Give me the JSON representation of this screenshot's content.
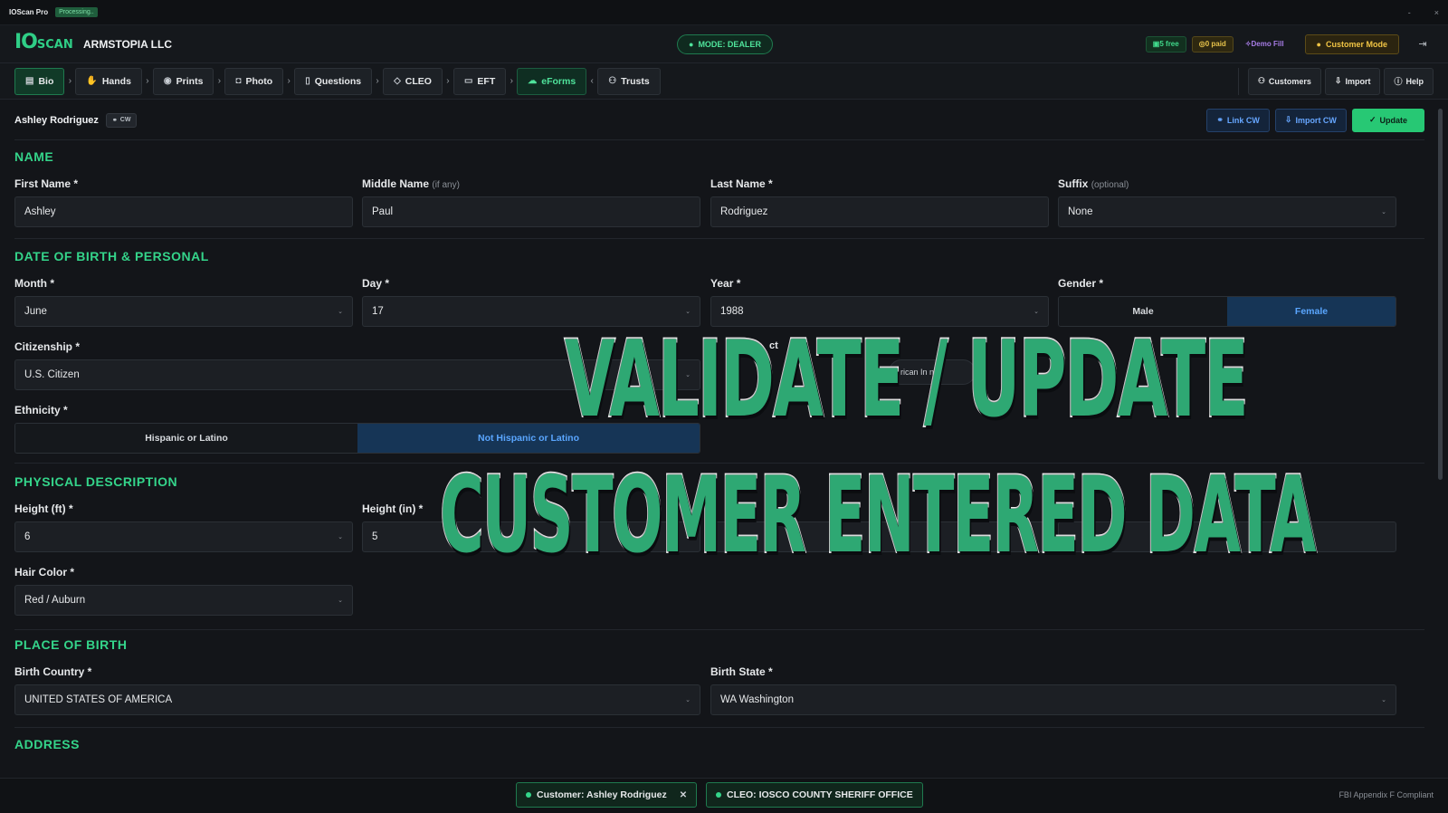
{
  "titlebar": {
    "app": "IOScan Pro",
    "status": "Processing..",
    "minimize": "-",
    "close": "×"
  },
  "header": {
    "logo_main": "IO",
    "logo_sub": "SCAN",
    "company": "ARMSTOPIA LLC",
    "mode": "MODE: DEALER",
    "free": "5 free",
    "paid": "0 paid",
    "demo": "Demo Fill",
    "customer_mode": "Customer Mode"
  },
  "nav": {
    "tabs": [
      "Bio",
      "Hands",
      "Prints",
      "Photo",
      "Questions",
      "CLEO",
      "EFT",
      "eForms",
      "Trusts"
    ],
    "right": [
      "Customers",
      "Import",
      "Help"
    ]
  },
  "person": {
    "name": "Ashley Rodriguez",
    "tag": "CW",
    "link_cw": "Link CW",
    "import_cw": "Import CW",
    "update": "Update"
  },
  "name_section": {
    "title": "NAME",
    "first_label": "First Name *",
    "first": "Ashley",
    "middle_label": "Middle Name",
    "middle_hint": "(if any)",
    "middle": "Paul",
    "last_label": "Last Name *",
    "last": "Rodriguez",
    "suffix_label": "Suffix",
    "suffix_hint": "(optional)",
    "suffix": "None"
  },
  "dob_section": {
    "title": "DATE OF BIRTH & PERSONAL",
    "month_label": "Month *",
    "month": "June",
    "day_label": "Day *",
    "day": "17",
    "year_label": "Year *",
    "year": "1988",
    "gender_label": "Gender *",
    "gender_options": [
      "Male",
      "Female"
    ],
    "citizenship_label": "Citizenship *",
    "citizenship": "U.S. Citizen",
    "race_fragment": "ct",
    "race_chip": "rican In    n",
    "ethnicity_label": "Ethnicity *",
    "ethnicity_options": [
      "Hispanic or Latino",
      "Not Hispanic or Latino"
    ]
  },
  "physical_section": {
    "title": "PHYSICAL DESCRIPTION",
    "height_ft_label": "Height (ft) *",
    "height_ft": "6",
    "height_in_label": "Height (in) *",
    "height_in": "5",
    "hair_label": "Hair Color *",
    "hair": "Red / Auburn"
  },
  "birth_section": {
    "title": "PLACE OF BIRTH",
    "country_label": "Birth Country *",
    "country": "UNITED STATES OF AMERICA",
    "state_label": "Birth State *",
    "state": "WA Washington"
  },
  "address_section": {
    "title": "ADDRESS"
  },
  "overlay": {
    "line1": "VALIDATE / UPDATE",
    "line2": "CUSTOMER ENTERED DATA"
  },
  "footer": {
    "customer": "Customer: Ashley Rodriguez",
    "cleo": "CLEO: IOSCO COUNTY SHERIFF OFFICE",
    "compliance": "FBI Appendix F Compliant"
  },
  "colors": {
    "accent": "#34d48a",
    "selected": "#163556",
    "overlay_fill": "#2ea873"
  }
}
